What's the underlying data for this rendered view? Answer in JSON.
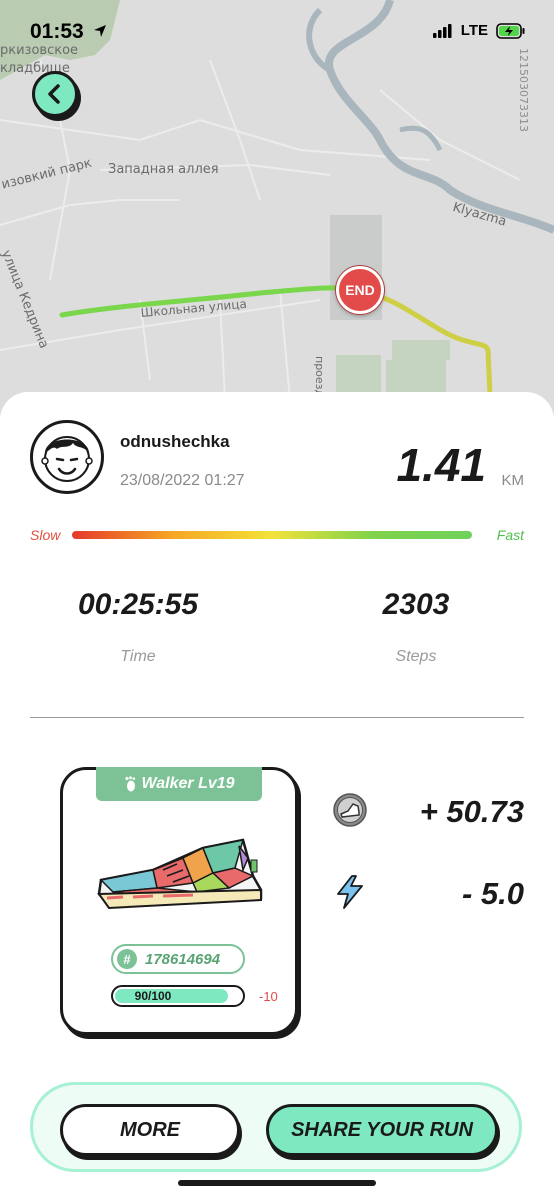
{
  "status_bar": {
    "time": "01:53",
    "network": "LTE"
  },
  "map": {
    "labels": {
      "cemetery": "ркизовское\nкладбище",
      "park": "изовкий парк",
      "alley": "Западная аллея",
      "river": "Klyazma",
      "street_kedrina": "улица Кедрина",
      "street_school": "Школьная улица",
      "proezd": "проезд",
      "side_code": "121503073313"
    },
    "end_label": "END"
  },
  "run": {
    "username": "odnushechka",
    "datetime": "23/08/2022 01:27",
    "distance": "1.41",
    "distance_unit": "KM",
    "speed_slow": "Slow",
    "speed_fast": "Fast",
    "time_value": "00:25:55",
    "time_label": "Time",
    "steps_value": "2303",
    "steps_label": "Steps"
  },
  "shoe": {
    "tag": "Walker Lv19",
    "id": "178614694",
    "durability_text": "90/100",
    "durability_fraction": 0.9,
    "durability_change": "-10"
  },
  "rewards": {
    "earned": "+ 50.73",
    "energy": "- 5.0"
  },
  "buttons": {
    "more": "MORE",
    "share": "SHARE YOUR RUN"
  },
  "colors": {
    "accent": "#7ee8c1",
    "green": "#7dc296",
    "red": "#e34b4b"
  }
}
